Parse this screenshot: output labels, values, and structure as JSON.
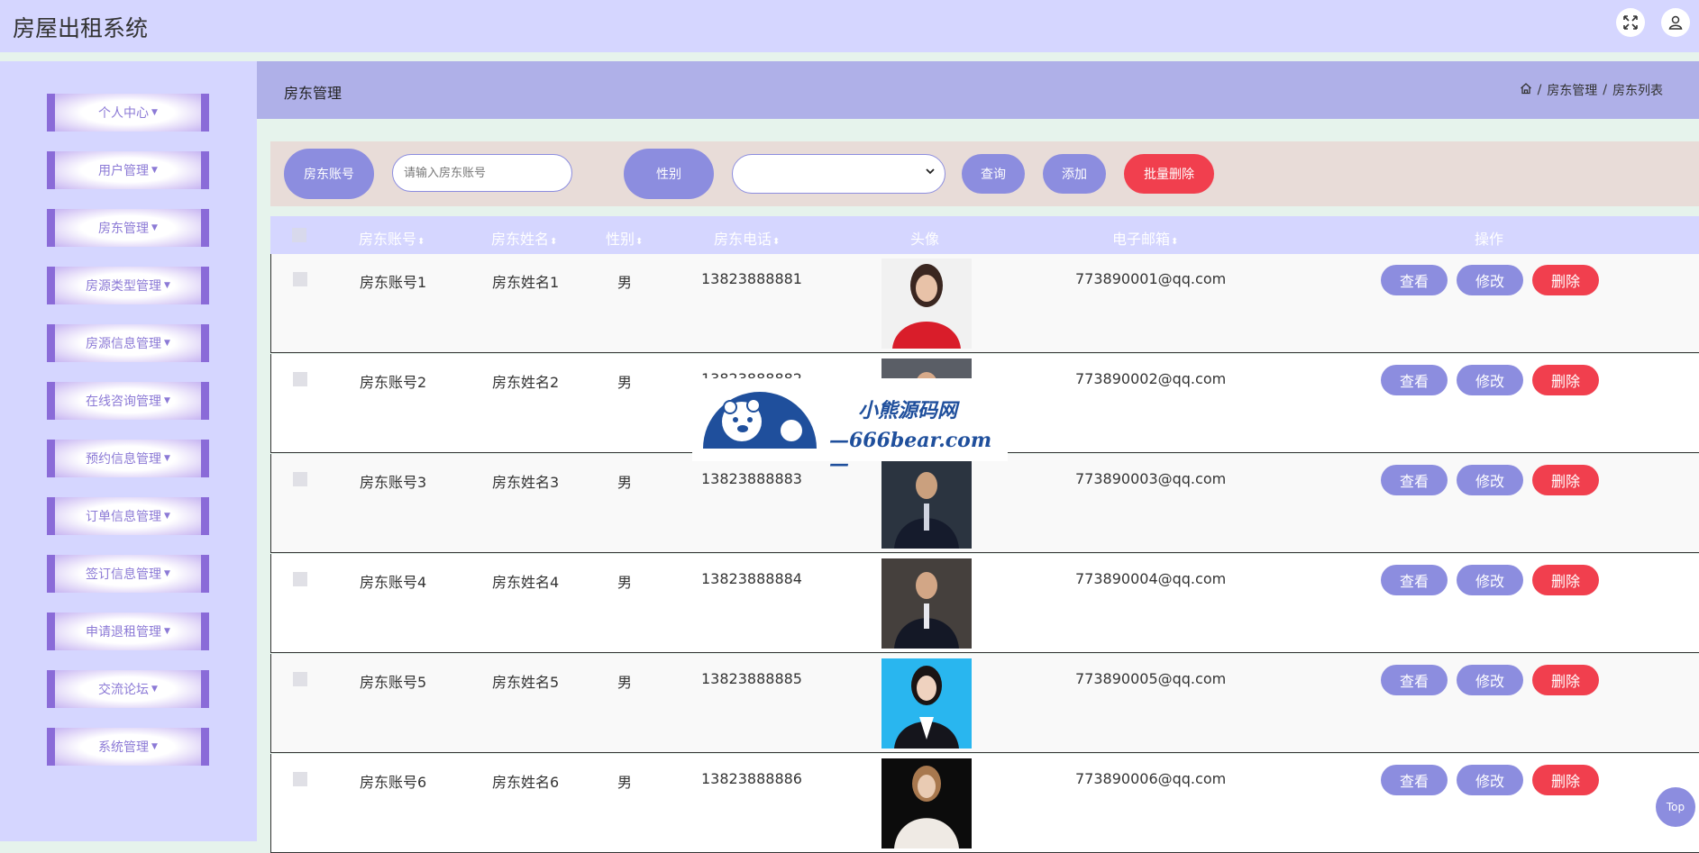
{
  "app": {
    "title": "房屋出租系统"
  },
  "topbar": {
    "fullscreen_icon": "expand-icon",
    "user_icon": "user-icon"
  },
  "sidebar": {
    "items": [
      {
        "label": "个人中心"
      },
      {
        "label": "用户管理"
      },
      {
        "label": "房东管理"
      },
      {
        "label": "房源类型管理"
      },
      {
        "label": "房源信息管理"
      },
      {
        "label": "在线咨询管理"
      },
      {
        "label": "预约信息管理"
      },
      {
        "label": "订单信息管理"
      },
      {
        "label": "签订信息管理"
      },
      {
        "label": "申请退租管理"
      },
      {
        "label": "交流论坛"
      },
      {
        "label": "系统管理"
      }
    ]
  },
  "header": {
    "page_title": "房东管理",
    "breadcrumb": [
      {
        "label": "房东管理"
      },
      {
        "label": "房东列表"
      }
    ],
    "separator": "/"
  },
  "filters": {
    "account_label": "房东账号",
    "account_placeholder": "请输入房东账号",
    "gender_label": "性别",
    "gender_value": "",
    "query_button": "查询",
    "add_button": "添加",
    "batch_delete_button": "批量删除"
  },
  "table": {
    "columns": [
      {
        "label": "房东账号",
        "sortable": true
      },
      {
        "label": "房东姓名",
        "sortable": true
      },
      {
        "label": "性别",
        "sortable": true
      },
      {
        "label": "房东电话",
        "sortable": true
      },
      {
        "label": "头像",
        "sortable": false
      },
      {
        "label": "电子邮箱",
        "sortable": true
      },
      {
        "label": "操作",
        "sortable": false
      }
    ],
    "rows": [
      {
        "account": "房东账号1",
        "name": "房东姓名1",
        "gender": "男",
        "phone": "13823888881",
        "email": "773890001@qq.com"
      },
      {
        "account": "房东账号2",
        "name": "房东姓名2",
        "gender": "男",
        "phone": "13823888882",
        "email": "773890002@qq.com"
      },
      {
        "account": "房东账号3",
        "name": "房东姓名3",
        "gender": "男",
        "phone": "13823888883",
        "email": "773890003@qq.com"
      },
      {
        "account": "房东账号4",
        "name": "房东姓名4",
        "gender": "男",
        "phone": "13823888884",
        "email": "773890004@qq.com"
      },
      {
        "account": "房东账号5",
        "name": "房东姓名5",
        "gender": "男",
        "phone": "13823888885",
        "email": "773890005@qq.com"
      },
      {
        "account": "房东账号6",
        "name": "房东姓名6",
        "gender": "男",
        "phone": "13823888886",
        "email": "773890006@qq.com"
      }
    ],
    "actions": {
      "view": "查看",
      "edit": "修改",
      "delete": "删除"
    }
  },
  "watermark": {
    "title": "小熊源码网",
    "url": "—666bear.com—"
  },
  "back_to_top": "Top",
  "colors": {
    "accent": "#8c8ddf",
    "danger": "#f13f4e",
    "sidebar": "#d5d6ff",
    "menu": "#8a6bd8"
  }
}
